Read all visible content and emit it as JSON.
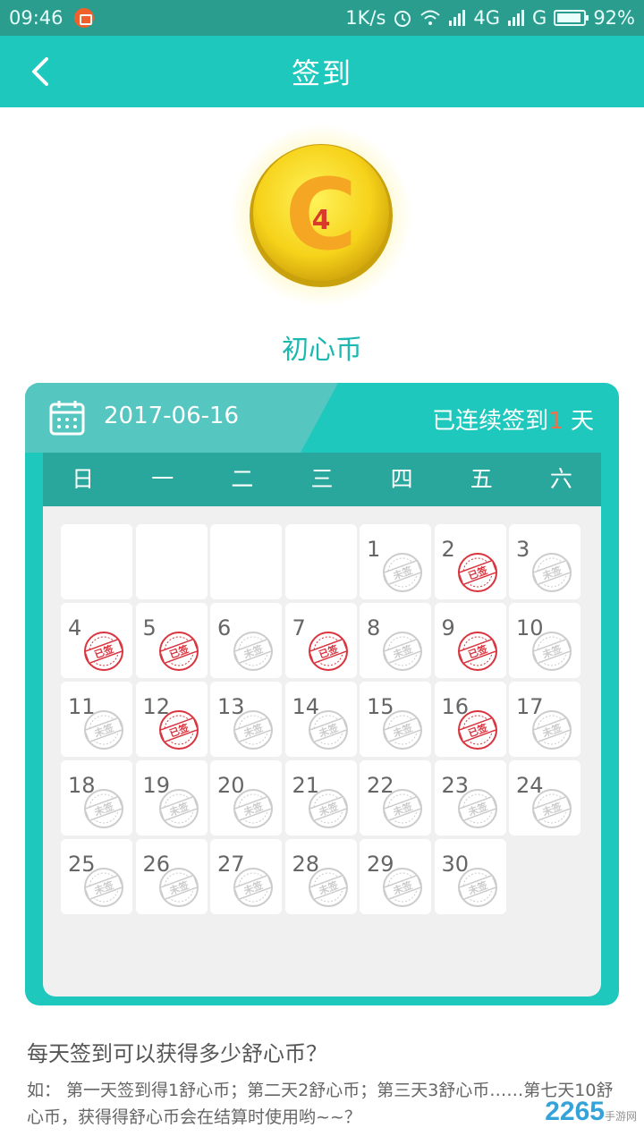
{
  "status_bar": {
    "time": "09:46",
    "speed": "1K/s",
    "network": "4G",
    "network2": "G",
    "battery": "92%",
    "battery_level": 0.92
  },
  "header": {
    "title": "签到",
    "back_icon": "chevron-left-icon"
  },
  "coin": {
    "letter": "C",
    "count": "4",
    "label": "初心币"
  },
  "calendar": {
    "date": "2017-06-16",
    "streak_prefix": "已连续签到",
    "streak_count": "1",
    "streak_suffix": " 天",
    "weekdays": [
      "日",
      "一",
      "二",
      "三",
      "四",
      "五",
      "六"
    ],
    "leading_blanks": 4,
    "days": [
      {
        "d": "1",
        "s": false
      },
      {
        "d": "2",
        "s": true
      },
      {
        "d": "3",
        "s": false
      },
      {
        "d": "4",
        "s": true
      },
      {
        "d": "5",
        "s": true
      },
      {
        "d": "6",
        "s": false
      },
      {
        "d": "7",
        "s": true
      },
      {
        "d": "8",
        "s": false
      },
      {
        "d": "9",
        "s": true
      },
      {
        "d": "10",
        "s": false
      },
      {
        "d": "11",
        "s": false
      },
      {
        "d": "12",
        "s": true
      },
      {
        "d": "13",
        "s": false
      },
      {
        "d": "14",
        "s": false
      },
      {
        "d": "15",
        "s": false
      },
      {
        "d": "16",
        "s": true
      },
      {
        "d": "17",
        "s": false
      },
      {
        "d": "18",
        "s": false
      },
      {
        "d": "19",
        "s": false
      },
      {
        "d": "20",
        "s": false
      },
      {
        "d": "21",
        "s": false
      },
      {
        "d": "22",
        "s": false
      },
      {
        "d": "23",
        "s": false
      },
      {
        "d": "24",
        "s": false
      },
      {
        "d": "25",
        "s": false
      },
      {
        "d": "26",
        "s": false
      },
      {
        "d": "27",
        "s": false
      },
      {
        "d": "28",
        "s": false
      },
      {
        "d": "29",
        "s": false
      },
      {
        "d": "30",
        "s": false
      }
    ],
    "stamp_signed": "已签",
    "stamp_unsigned": "未签"
  },
  "faq": {
    "title": "每天签到可以获得多少舒心币？",
    "body": "如： 第一天签到得1舒心币；第二天2舒心币；第三天3舒心币……第七天10舒心币，获得得舒心币会在结算时使用哟~~？"
  },
  "watermark": {
    "text": "2265",
    "sub": "手游网"
  },
  "colors": {
    "accent": "#1ec8bd",
    "status_bar": "#2a9d8f",
    "signed_stamp": "#d9343f",
    "unsigned_stamp": "#cccccc",
    "streak_number": "#f07048"
  }
}
